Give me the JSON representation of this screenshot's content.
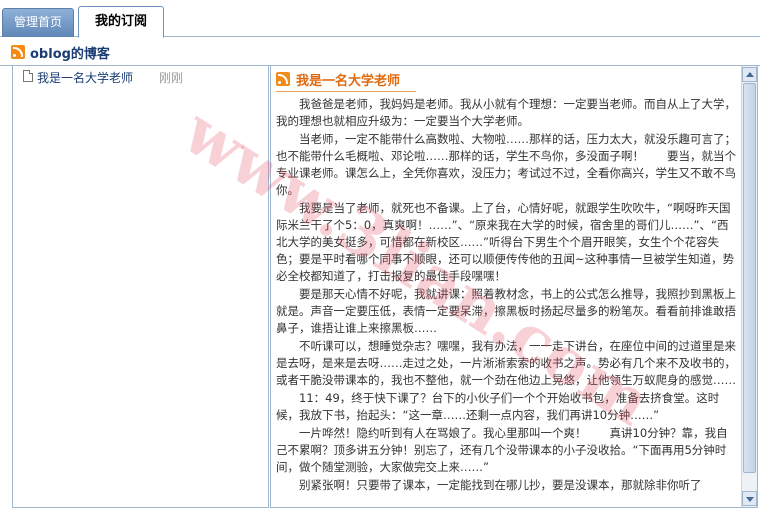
{
  "tabs": [
    {
      "label": "管理首页",
      "active": false
    },
    {
      "label": "我的订阅",
      "active": true
    }
  ],
  "blog": {
    "title": "oblog的博客",
    "icon": "rss-icon"
  },
  "posts": [
    {
      "title": "我是一名大学老师",
      "time": "刚刚",
      "icon": "document-icon"
    }
  ],
  "article": {
    "title": "我是一名大学老师",
    "paragraphs": [
      "我爸爸是老师，我妈妈是老师。我从小就有个理想：一定要当老师。而自从上了大学，我的理想也就相应升级为：一定要当个大学老师。",
      "当老师，一定不能带什么高数啦、大物啦……那样的话，压力太大，就没乐趣可言了；也不能带什么毛概啦、邓论啦……那样的话，学生不鸟你，多没面子啊！　　要当，就当个专业课老师。课怎么上，全凭你喜欢，没压力；考试过不过，全看你高兴，学生又不敢不鸟你。",
      "我要是当了老师，就死也不备课。上了台，心情好呢，就跟学生吹吹牛，“啊呀昨天国际米兰干了个5：0，真爽啊！……”、“原来我在大学的时候，宿舍里的哥们儿……”、“西北大学的美女挺多，可惜都在新校区……”听得台下男生个个眉开眼笑，女生个个花容失色；要是平时看哪个同事不顺眼，还可以顺便传传他的丑闻~这种事情一旦被学生知道，势必全校都知道了，打击报复的最佳手段嘿嘿！",
      "要是那天心情不好呢，我就讲课：照着教材念，书上的公式怎么推导，我照抄到黑板上就是。声音一定要压低，表情一定要呆滞，擦黑板时扬起尽量多的粉笔灰。看看前排谁敢捂鼻子，谁捂让谁上来擦黑板……",
      "不听课可以，想睡觉杂志？嘿嘿，我有办法，一一走下讲台，在座位中间的过道里是来是去呀，是来是去呀……走过之处，一片淅淅索索的收书之声。势必有几个来不及收书的，或者干脆没带课本的，我也不整他，就一个劲在他边上晃悠，让他领生万蚁爬身的感觉……",
      "11：49，终于快下课了？台下的小伙子们一个个开始收书包，准备去挤食堂。这时候，我放下书，抬起头：“这一章……还剩一点内容，我们再讲10分钟……”",
      "一片哗然！隐约听到有人在骂娘了。我心里那叫一个爽！　　真讲10分钟？靠，我自己不累啊？顶多讲五分钟！别忘了，还有几个没带课本的小子没收拾。“下面再用5分钟时间，做个随堂测验，大家做完交上来……”",
      "别紧张啊！只要带了课本，一定能找到在哪儿抄，要是没课本，那就除非你听了"
    ]
  },
  "watermark": "www.3lian.com"
}
